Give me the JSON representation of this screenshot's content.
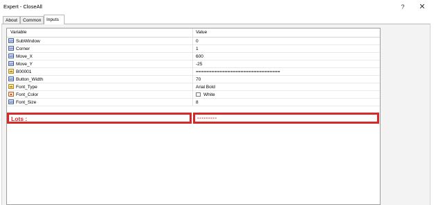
{
  "window": {
    "title": "Expert - CloseAll",
    "help_glyph": "?",
    "close_glyph": "✕"
  },
  "tabs": [
    {
      "label": "About",
      "active": false
    },
    {
      "label": "Common",
      "active": false
    },
    {
      "label": "Inputs",
      "active": true
    }
  ],
  "grid": {
    "columns": [
      "Variable",
      "Value"
    ],
    "rows": [
      {
        "name": "SubWindow",
        "value": "0",
        "icon": "int-icon",
        "icon_text": "123"
      },
      {
        "name": "Corner",
        "value": "1",
        "icon": "int-icon",
        "icon_text": "123"
      },
      {
        "name": "Move_X",
        "value": "600",
        "icon": "int-icon",
        "icon_text": "123"
      },
      {
        "name": "Move_Y",
        "value": "-25",
        "icon": "int-icon",
        "icon_text": "123"
      },
      {
        "name": "B00001",
        "value": "================================",
        "icon": "string-icon",
        "icon_text": "ab"
      },
      {
        "name": "Button_Width",
        "value": "70",
        "icon": "int-icon",
        "icon_text": "123"
      },
      {
        "name": "Font_Type",
        "value": "Arial Bold",
        "icon": "string-icon",
        "icon_text": "ab"
      },
      {
        "name": "Font_Color",
        "value": "White",
        "icon": "color-icon",
        "icon_text": "■"
      },
      {
        "name": "Font_Size",
        "value": "8",
        "icon": "int-icon",
        "icon_text": "123"
      }
    ],
    "highlight_row": {
      "name": "Lots :",
      "value": "---------"
    }
  },
  "colors": {
    "highlight": "#d42a2a",
    "font_color_swatch": "#ffffff"
  }
}
